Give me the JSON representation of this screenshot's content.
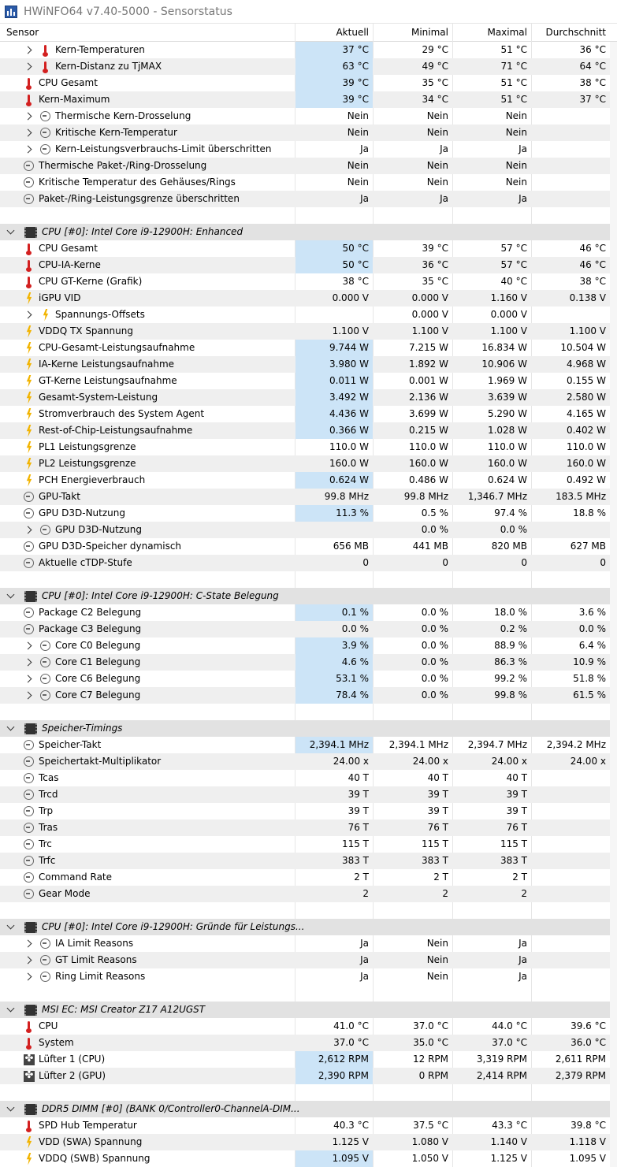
{
  "window": {
    "title": "HWiNFO64 v7.40-5000 - Sensorstatus"
  },
  "columns": {
    "sensor": "Sensor",
    "current": "Aktuell",
    "min": "Minimal",
    "max": "Maximal",
    "avg": "Durchschnitt"
  },
  "colors": {
    "highlight": "#cce4f7",
    "group_bg": "#e2e2e2",
    "alt_row": "#efefef",
    "thermometer": "#d32020",
    "bolt": "#f2b400"
  },
  "rows": [
    {
      "type": "sensor",
      "indent": 1,
      "expand": "collapsed",
      "icon": "thermometer-icon",
      "name": "Kern-Temperaturen",
      "cur": "37 °C",
      "min": "29 °C",
      "max": "51 °C",
      "avg": "36 °C",
      "hl": true
    },
    {
      "type": "sensor",
      "indent": 1,
      "expand": "collapsed",
      "icon": "thermometer-icon",
      "name": "Kern-Distanz zu TjMAX",
      "cur": "63 °C",
      "min": "49 °C",
      "max": "71 °C",
      "avg": "64 °C",
      "hl": true
    },
    {
      "type": "sensor",
      "indent": 0,
      "icon": "thermometer-icon",
      "name": "CPU Gesamt",
      "cur": "39 °C",
      "min": "35 °C",
      "max": "51 °C",
      "avg": "38 °C",
      "hl": true
    },
    {
      "type": "sensor",
      "indent": 0,
      "icon": "thermometer-icon",
      "name": "Kern-Maximum",
      "cur": "39 °C",
      "min": "34 °C",
      "max": "51 °C",
      "avg": "37 °C",
      "hl": true
    },
    {
      "type": "sensor",
      "indent": 1,
      "expand": "collapsed",
      "icon": "clock-icon",
      "name": "Thermische Kern-Drosselung",
      "cur": "Nein",
      "min": "Nein",
      "max": "Nein",
      "avg": ""
    },
    {
      "type": "sensor",
      "indent": 1,
      "expand": "collapsed",
      "icon": "clock-icon",
      "name": "Kritische Kern-Temperatur",
      "cur": "Nein",
      "min": "Nein",
      "max": "Nein",
      "avg": ""
    },
    {
      "type": "sensor",
      "indent": 1,
      "expand": "collapsed",
      "icon": "clock-icon",
      "name": "Kern-Leistungsverbrauchs-Limit überschritten",
      "cur": "Ja",
      "min": "Ja",
      "max": "Ja",
      "avg": ""
    },
    {
      "type": "sensor",
      "indent": 0,
      "icon": "clock-icon",
      "name": "Thermische Paket-/Ring-Drosselung",
      "cur": "Nein",
      "min": "Nein",
      "max": "Nein",
      "avg": ""
    },
    {
      "type": "sensor",
      "indent": 0,
      "icon": "clock-icon",
      "name": "Kritische Temperatur des Gehäuses/Rings",
      "cur": "Nein",
      "min": "Nein",
      "max": "Nein",
      "avg": ""
    },
    {
      "type": "sensor",
      "indent": 0,
      "icon": "clock-icon",
      "name": "Paket-/Ring-Leistungsgrenze überschritten",
      "cur": "Ja",
      "min": "Ja",
      "max": "Ja",
      "avg": ""
    },
    {
      "type": "blank"
    },
    {
      "type": "group",
      "name": "CPU [#0]: Intel Core i9-12900H: Enhanced"
    },
    {
      "type": "sensor",
      "indent": 0,
      "icon": "thermometer-icon",
      "name": "CPU Gesamt",
      "cur": "50 °C",
      "min": "39 °C",
      "max": "57 °C",
      "avg": "46 °C",
      "hl": true
    },
    {
      "type": "sensor",
      "indent": 0,
      "icon": "thermometer-icon",
      "name": "CPU-IA-Kerne",
      "cur": "50 °C",
      "min": "36 °C",
      "max": "57 °C",
      "avg": "46 °C",
      "hl": true
    },
    {
      "type": "sensor",
      "indent": 0,
      "icon": "thermometer-icon",
      "name": "CPU GT-Kerne (Grafik)",
      "cur": "38 °C",
      "min": "35 °C",
      "max": "40 °C",
      "avg": "38 °C"
    },
    {
      "type": "sensor",
      "indent": 0,
      "icon": "bolt-icon",
      "name": "iGPU VID",
      "cur": "0.000 V",
      "min": "0.000 V",
      "max": "1.160 V",
      "avg": "0.138 V"
    },
    {
      "type": "sensor",
      "indent": 1,
      "expand": "collapsed",
      "icon": "bolt-icon",
      "name": "Spannungs-Offsets",
      "cur": "",
      "min": "0.000 V",
      "max": "0.000 V",
      "avg": ""
    },
    {
      "type": "sensor",
      "indent": 0,
      "icon": "bolt-icon",
      "name": "VDDQ TX Spannung",
      "cur": "1.100 V",
      "min": "1.100 V",
      "max": "1.100 V",
      "avg": "1.100 V"
    },
    {
      "type": "sensor",
      "indent": 0,
      "icon": "bolt-icon",
      "name": "CPU-Gesamt-Leistungsaufnahme",
      "cur": "9.744 W",
      "min": "7.215 W",
      "max": "16.834 W",
      "avg": "10.504 W",
      "hl": true
    },
    {
      "type": "sensor",
      "indent": 0,
      "icon": "bolt-icon",
      "name": "IA-Kerne Leistungsaufnahme",
      "cur": "3.980 W",
      "min": "1.892 W",
      "max": "10.906 W",
      "avg": "4.968 W",
      "hl": true
    },
    {
      "type": "sensor",
      "indent": 0,
      "icon": "bolt-icon",
      "name": "GT-Kerne Leistungsaufnahme",
      "cur": "0.011 W",
      "min": "0.001 W",
      "max": "1.969 W",
      "avg": "0.155 W",
      "hl": true
    },
    {
      "type": "sensor",
      "indent": 0,
      "icon": "bolt-icon",
      "name": "Gesamt-System-Leistung",
      "cur": "3.492 W",
      "min": "2.136 W",
      "max": "3.639 W",
      "avg": "2.580 W",
      "hl": true
    },
    {
      "type": "sensor",
      "indent": 0,
      "icon": "bolt-icon",
      "name": "Stromverbrauch des System Agent",
      "cur": "4.436 W",
      "min": "3.699 W",
      "max": "5.290 W",
      "avg": "4.165 W",
      "hl": true
    },
    {
      "type": "sensor",
      "indent": 0,
      "icon": "bolt-icon",
      "name": "Rest-of-Chip-Leistungsaufnahme",
      "cur": "0.366 W",
      "min": "0.215 W",
      "max": "1.028 W",
      "avg": "0.402 W",
      "hl": true
    },
    {
      "type": "sensor",
      "indent": 0,
      "icon": "bolt-icon",
      "name": "PL1 Leistungsgrenze",
      "cur": "110.0 W",
      "min": "110.0 W",
      "max": "110.0 W",
      "avg": "110.0 W"
    },
    {
      "type": "sensor",
      "indent": 0,
      "icon": "bolt-icon",
      "name": "PL2 Leistungsgrenze",
      "cur": "160.0 W",
      "min": "160.0 W",
      "max": "160.0 W",
      "avg": "160.0 W"
    },
    {
      "type": "sensor",
      "indent": 0,
      "icon": "bolt-icon",
      "name": "PCH Energieverbrauch",
      "cur": "0.624 W",
      "min": "0.486 W",
      "max": "0.624 W",
      "avg": "0.492 W",
      "hl": true
    },
    {
      "type": "sensor",
      "indent": 0,
      "icon": "clock-icon",
      "name": "GPU-Takt",
      "cur": "99.8 MHz",
      "min": "99.8 MHz",
      "max": "1,346.7 MHz",
      "avg": "183.5 MHz"
    },
    {
      "type": "sensor",
      "indent": 0,
      "icon": "clock-icon",
      "name": "GPU D3D-Nutzung",
      "cur": "11.3 %",
      "min": "0.5 %",
      "max": "97.4 %",
      "avg": "18.8 %",
      "hl": true
    },
    {
      "type": "sensor",
      "indent": 1,
      "expand": "collapsed",
      "icon": "clock-icon",
      "name": "GPU D3D-Nutzung",
      "cur": "",
      "min": "0.0 %",
      "max": "0.0 %",
      "avg": ""
    },
    {
      "type": "sensor",
      "indent": 0,
      "icon": "clock-icon",
      "name": "GPU D3D-Speicher dynamisch",
      "cur": "656 MB",
      "min": "441 MB",
      "max": "820 MB",
      "avg": "627 MB"
    },
    {
      "type": "sensor",
      "indent": 0,
      "icon": "clock-icon",
      "name": "Aktuelle cTDP-Stufe",
      "cur": "0",
      "min": "0",
      "max": "0",
      "avg": "0"
    },
    {
      "type": "blank"
    },
    {
      "type": "group",
      "name": "CPU [#0]: Intel Core i9-12900H: C-State Belegung"
    },
    {
      "type": "sensor",
      "indent": 0,
      "icon": "clock-icon",
      "name": "Package C2 Belegung",
      "cur": "0.1 %",
      "min": "0.0 %",
      "max": "18.0 %",
      "avg": "3.6 %",
      "hl": true
    },
    {
      "type": "sensor",
      "indent": 0,
      "icon": "clock-icon",
      "name": "Package C3 Belegung",
      "cur": "0.0 %",
      "min": "0.0 %",
      "max": "0.2 %",
      "avg": "0.0 %"
    },
    {
      "type": "sensor",
      "indent": 1,
      "expand": "collapsed",
      "icon": "clock-icon",
      "name": "Core C0 Belegung",
      "cur": "3.9 %",
      "min": "0.0 %",
      "max": "88.9 %",
      "avg": "6.4 %",
      "hl": true
    },
    {
      "type": "sensor",
      "indent": 1,
      "expand": "collapsed",
      "icon": "clock-icon",
      "name": "Core C1 Belegung",
      "cur": "4.6 %",
      "min": "0.0 %",
      "max": "86.3 %",
      "avg": "10.9 %",
      "hl": true
    },
    {
      "type": "sensor",
      "indent": 1,
      "expand": "collapsed",
      "icon": "clock-icon",
      "name": "Core C6 Belegung",
      "cur": "53.1 %",
      "min": "0.0 %",
      "max": "99.2 %",
      "avg": "51.8 %",
      "hl": true
    },
    {
      "type": "sensor",
      "indent": 1,
      "expand": "collapsed",
      "icon": "clock-icon",
      "name": "Core C7 Belegung",
      "cur": "78.4 %",
      "min": "0.0 %",
      "max": "99.8 %",
      "avg": "61.5 %",
      "hl": true
    },
    {
      "type": "blank"
    },
    {
      "type": "group",
      "name": "Speicher-Timings"
    },
    {
      "type": "sensor",
      "indent": 0,
      "icon": "clock-icon",
      "name": "Speicher-Takt",
      "cur": "2,394.1 MHz",
      "min": "2,394.1 MHz",
      "max": "2,394.7 MHz",
      "avg": "2,394.2 MHz",
      "hl": true
    },
    {
      "type": "sensor",
      "indent": 0,
      "icon": "clock-icon",
      "name": "Speichertakt-Multiplikator",
      "cur": "24.00 x",
      "min": "24.00 x",
      "max": "24.00 x",
      "avg": "24.00 x"
    },
    {
      "type": "sensor",
      "indent": 0,
      "icon": "clock-icon",
      "name": "Tcas",
      "cur": "40 T",
      "min": "40 T",
      "max": "40 T",
      "avg": ""
    },
    {
      "type": "sensor",
      "indent": 0,
      "icon": "clock-icon",
      "name": "Trcd",
      "cur": "39 T",
      "min": "39 T",
      "max": "39 T",
      "avg": ""
    },
    {
      "type": "sensor",
      "indent": 0,
      "icon": "clock-icon",
      "name": "Trp",
      "cur": "39 T",
      "min": "39 T",
      "max": "39 T",
      "avg": ""
    },
    {
      "type": "sensor",
      "indent": 0,
      "icon": "clock-icon",
      "name": "Tras",
      "cur": "76 T",
      "min": "76 T",
      "max": "76 T",
      "avg": ""
    },
    {
      "type": "sensor",
      "indent": 0,
      "icon": "clock-icon",
      "name": "Trc",
      "cur": "115 T",
      "min": "115 T",
      "max": "115 T",
      "avg": ""
    },
    {
      "type": "sensor",
      "indent": 0,
      "icon": "clock-icon",
      "name": "Trfc",
      "cur": "383 T",
      "min": "383 T",
      "max": "383 T",
      "avg": ""
    },
    {
      "type": "sensor",
      "indent": 0,
      "icon": "clock-icon",
      "name": "Command Rate",
      "cur": "2 T",
      "min": "2 T",
      "max": "2 T",
      "avg": ""
    },
    {
      "type": "sensor",
      "indent": 0,
      "icon": "clock-icon",
      "name": "Gear Mode",
      "cur": "2",
      "min": "2",
      "max": "2",
      "avg": ""
    },
    {
      "type": "blank"
    },
    {
      "type": "group",
      "name": "CPU [#0]: Intel Core i9-12900H: Gründe für Leistungs..."
    },
    {
      "type": "sensor",
      "indent": 1,
      "expand": "collapsed",
      "icon": "clock-icon",
      "name": "IA Limit Reasons",
      "cur": "Ja",
      "min": "Nein",
      "max": "Ja",
      "avg": ""
    },
    {
      "type": "sensor",
      "indent": 1,
      "expand": "collapsed",
      "icon": "clock-icon",
      "name": "GT Limit Reasons",
      "cur": "Ja",
      "min": "Nein",
      "max": "Ja",
      "avg": ""
    },
    {
      "type": "sensor",
      "indent": 1,
      "expand": "collapsed",
      "icon": "clock-icon",
      "name": "Ring Limit Reasons",
      "cur": "Ja",
      "min": "Nein",
      "max": "Ja",
      "avg": ""
    },
    {
      "type": "blank"
    },
    {
      "type": "group",
      "name": "MSI EC: MSI Creator Z17 A12UGST"
    },
    {
      "type": "sensor",
      "indent": 0,
      "icon": "thermometer-icon",
      "name": "CPU",
      "cur": "41.0 °C",
      "min": "37.0 °C",
      "max": "44.0 °C",
      "avg": "39.6 °C"
    },
    {
      "type": "sensor",
      "indent": 0,
      "icon": "thermometer-icon",
      "name": "System",
      "cur": "37.0 °C",
      "min": "35.0 °C",
      "max": "37.0 °C",
      "avg": "36.0 °C"
    },
    {
      "type": "sensor",
      "indent": 0,
      "icon": "fan-icon",
      "name": "Lüfter 1 (CPU)",
      "cur": "2,612 RPM",
      "min": "12 RPM",
      "max": "3,319 RPM",
      "avg": "2,611 RPM",
      "hl": true
    },
    {
      "type": "sensor",
      "indent": 0,
      "icon": "fan-icon",
      "name": "Lüfter 2 (GPU)",
      "cur": "2,390 RPM",
      "min": "0 RPM",
      "max": "2,414 RPM",
      "avg": "2,379 RPM",
      "hl": true
    },
    {
      "type": "blank"
    },
    {
      "type": "group",
      "name": "DDR5 DIMM [#0] (BANK 0/Controller0-ChannelA-DIM..."
    },
    {
      "type": "sensor",
      "indent": 0,
      "icon": "thermometer-icon",
      "name": "SPD Hub Temperatur",
      "cur": "40.3 °C",
      "min": "37.5 °C",
      "max": "43.3 °C",
      "avg": "39.8 °C"
    },
    {
      "type": "sensor",
      "indent": 0,
      "icon": "bolt-icon",
      "name": "VDD (SWA) Spannung",
      "cur": "1.125 V",
      "min": "1.080 V",
      "max": "1.140 V",
      "avg": "1.118 V"
    },
    {
      "type": "sensor",
      "indent": 0,
      "icon": "bolt-icon",
      "name": "VDDQ (SWB) Spannung",
      "cur": "1.095 V",
      "min": "1.050 V",
      "max": "1.125 V",
      "avg": "1.095 V",
      "hl": true
    }
  ]
}
